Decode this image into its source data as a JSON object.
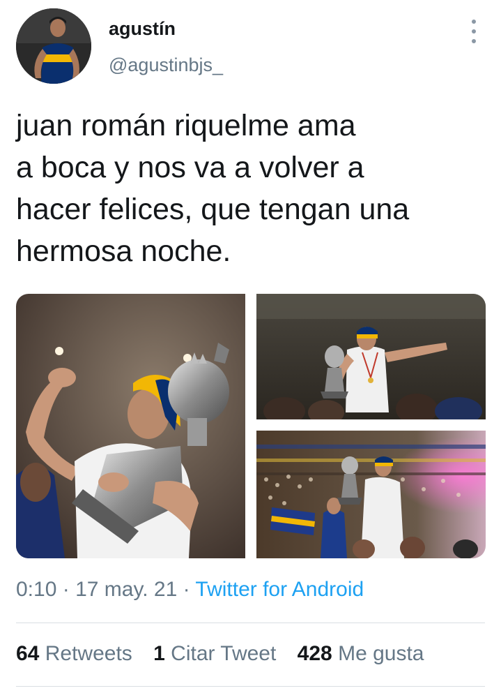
{
  "author": {
    "display_name": "agustín",
    "handle": "@agustinbjs_",
    "avatar_icon": "user-avatar-photo"
  },
  "more_icon": "more-options-icon",
  "tweet": {
    "text_lines": [
      "juan román riquelme ama",
      "a boca y nos va a volver a",
      "hacer felices, que tengan una",
      "hermosa noche."
    ]
  },
  "media": {
    "count": 3,
    "photos": [
      "photo-trophy-closeup",
      "photo-trophy-crowd-arms",
      "photo-stadium-celebration"
    ]
  },
  "meta": {
    "time": "0:10",
    "separator": "·",
    "date": "17 may. 21",
    "source": "Twitter for Android"
  },
  "stats": {
    "retweets_count": "64",
    "retweets_label": "Retweets",
    "quotes_count": "1",
    "quotes_label": "Citar Tweet",
    "likes_count": "428",
    "likes_label": "Me gusta"
  },
  "colors": {
    "text": "#14171a",
    "secondary": "#657786",
    "link": "#1da1f2",
    "divider": "#d9dee3",
    "boca_blue": "#0a2f6e",
    "boca_gold": "#f2b705"
  }
}
